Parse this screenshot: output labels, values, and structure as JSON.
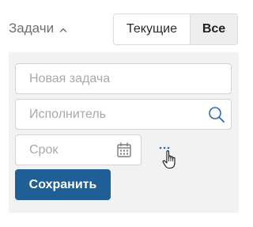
{
  "header": {
    "title": "Задачи",
    "title_icon": "chevron-up-icon"
  },
  "filter": {
    "options": [
      {
        "label": "Текущие",
        "selected": false
      },
      {
        "label": "Все",
        "selected": true
      }
    ]
  },
  "form": {
    "task_placeholder": "Новая задача",
    "assignee_placeholder": "Исполнитель",
    "assignee_icon": "search-icon",
    "due_placeholder": "Срок",
    "due_icon": "calendar-icon",
    "more_icon": "more-dots-icon",
    "save_label": "Сохранить"
  },
  "colors": {
    "primary": "#1f5f95",
    "panel_bg": "#f2f2f2",
    "link_blue": "#2a6bb0"
  }
}
